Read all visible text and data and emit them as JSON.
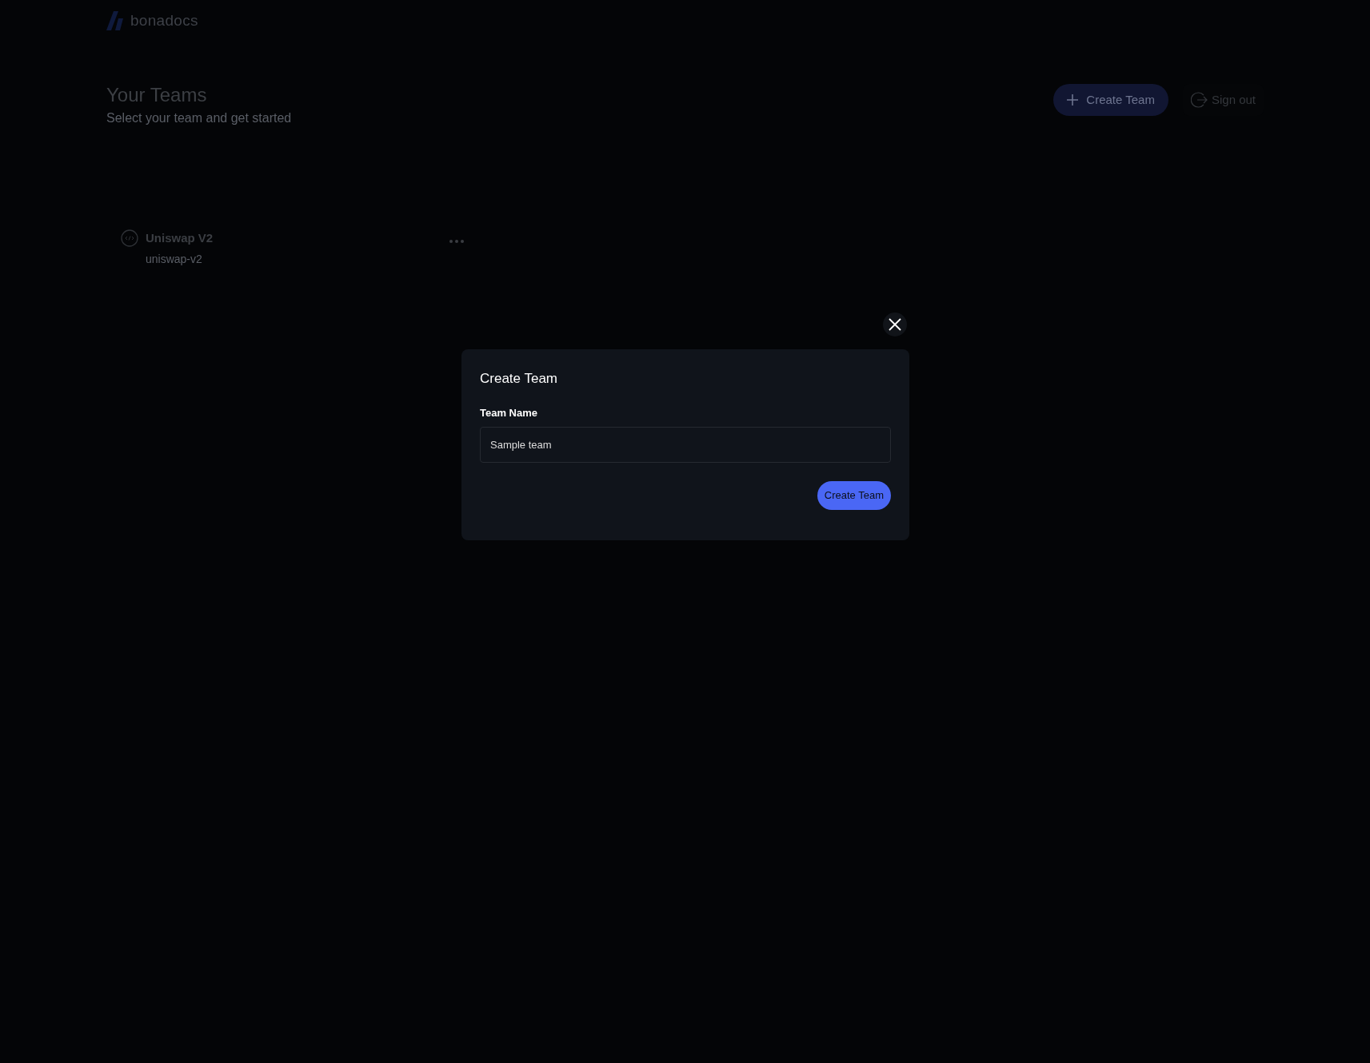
{
  "header": {
    "logo_text": "bonadocs"
  },
  "page": {
    "title": "Your Teams",
    "subtitle": "Select your team and get started",
    "actions": [
      {
        "kind": "primary",
        "label": "Create Team"
      },
      {
        "kind": "signout",
        "label": "Sign out"
      }
    ]
  },
  "teams": [
    {
      "name": "Uniswap V2",
      "slug": "uniswap-v2"
    }
  ],
  "modal": {
    "title": "Create Team",
    "field_label": "Team Name",
    "field_value": "Sample team",
    "submit": "Create Team"
  }
}
